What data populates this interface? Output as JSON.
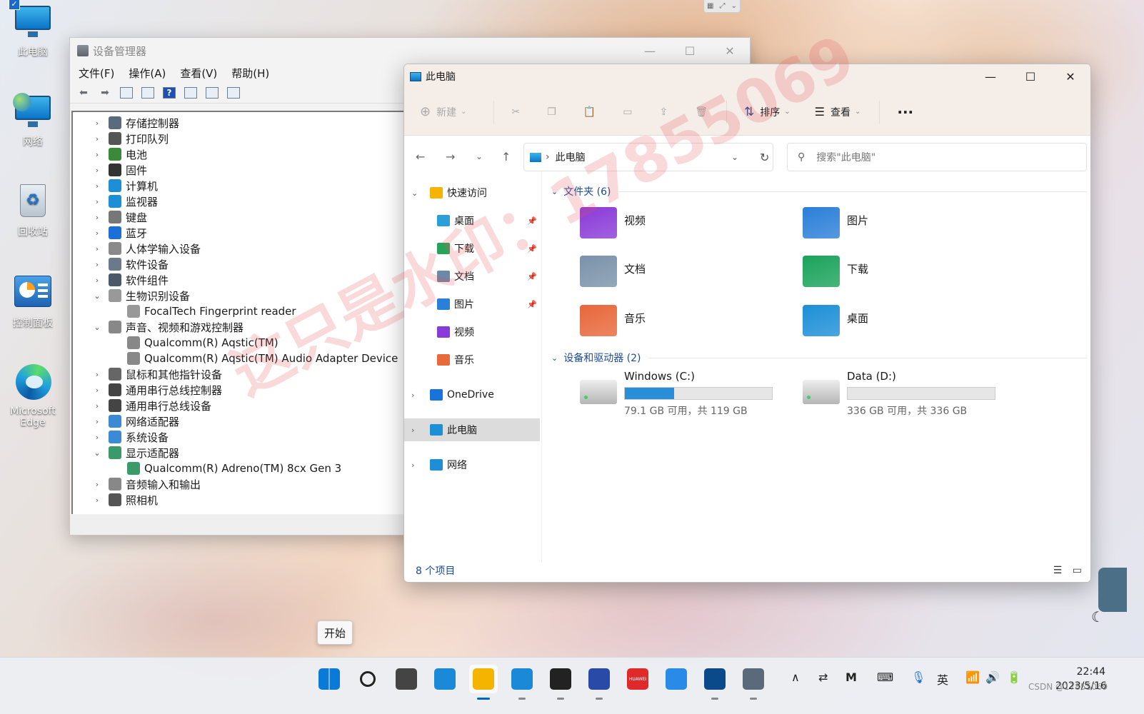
{
  "desktop": {
    "icons": [
      {
        "label": "此电脑",
        "icon": "this-pc-icon"
      },
      {
        "label": "网络",
        "icon": "network-icon"
      },
      {
        "label": "回收站",
        "icon": "recycle-bin-icon"
      },
      {
        "label": "控制面板",
        "icon": "control-panel-icon"
      },
      {
        "label": "Microsoft Edge",
        "icon": "edge-icon"
      }
    ]
  },
  "device_manager": {
    "title": "设备管理器",
    "menu": [
      "文件(F)",
      "操作(A)",
      "查看(V)",
      "帮助(H)"
    ],
    "tree": [
      {
        "label": "存储控制器",
        "level": 0,
        "expanded": false,
        "color": "#5a6b7d"
      },
      {
        "label": "打印队列",
        "level": 0,
        "expanded": false,
        "color": "#555555"
      },
      {
        "label": "电池",
        "level": 0,
        "expanded": false,
        "color": "#3a8a3a"
      },
      {
        "label": "固件",
        "level": 0,
        "expanded": false,
        "color": "#333333"
      },
      {
        "label": "计算机",
        "level": 0,
        "expanded": false,
        "color": "#1c8fd6"
      },
      {
        "label": "监视器",
        "level": 0,
        "expanded": false,
        "color": "#1c8fd6"
      },
      {
        "label": "键盘",
        "level": 0,
        "expanded": false,
        "color": "#777777"
      },
      {
        "label": "蓝牙",
        "level": 0,
        "expanded": false,
        "color": "#1a6fd8"
      },
      {
        "label": "人体学输入设备",
        "level": 0,
        "expanded": false,
        "color": "#8a8a8a"
      },
      {
        "label": "软件设备",
        "level": 0,
        "expanded": false,
        "color": "#6a7a8a"
      },
      {
        "label": "软件组件",
        "level": 0,
        "expanded": false,
        "color": "#4a5a6a"
      },
      {
        "label": "生物识别设备",
        "level": 0,
        "expanded": true,
        "color": "#999999"
      },
      {
        "label": "FocalTech Fingerprint reader",
        "level": 1,
        "color": "#999999"
      },
      {
        "label": "声音、视频和游戏控制器",
        "level": 0,
        "expanded": true,
        "color": "#888888"
      },
      {
        "label": "Qualcomm(R) Aqstic(TM)",
        "level": 1,
        "color": "#888888"
      },
      {
        "label": "Qualcomm(R) Aqstic(TM) Audio Adapter Device",
        "level": 1,
        "color": "#888888"
      },
      {
        "label": "鼠标和其他指针设备",
        "level": 0,
        "expanded": false,
        "color": "#666666"
      },
      {
        "label": "通用串行总线控制器",
        "level": 0,
        "expanded": false,
        "color": "#444444"
      },
      {
        "label": "通用串行总线设备",
        "level": 0,
        "expanded": false,
        "color": "#444444"
      },
      {
        "label": "网络适配器",
        "level": 0,
        "expanded": false,
        "color": "#3a8ad6"
      },
      {
        "label": "系统设备",
        "level": 0,
        "expanded": false,
        "color": "#3a8ad6"
      },
      {
        "label": "显示适配器",
        "level": 0,
        "expanded": true,
        "color": "#3a9a6a"
      },
      {
        "label": "Qualcomm(R) Adreno(TM) 8cx Gen 3",
        "level": 1,
        "color": "#3a9a6a"
      },
      {
        "label": "音频输入和输出",
        "level": 0,
        "expanded": false,
        "color": "#888888"
      },
      {
        "label": "照相机",
        "level": 0,
        "expanded": false,
        "color": "#555555"
      }
    ]
  },
  "explorer": {
    "title": "此电脑",
    "commands": [
      {
        "label": "新建",
        "enabled": false
      },
      {
        "label": "排序",
        "enabled": true
      },
      {
        "label": "查看",
        "enabled": true
      }
    ],
    "address": "此电脑",
    "search_placeholder": "搜索\"此电脑\"",
    "nav": [
      {
        "label": "快速访问",
        "type": "header",
        "icon": "star-icon",
        "color": "#f5b400"
      },
      {
        "label": "桌面",
        "type": "pinned",
        "icon": "desktop-icon",
        "color": "#2a9fd8"
      },
      {
        "label": "下载",
        "type": "pinned",
        "icon": "download-icon",
        "color": "#2aa35a"
      },
      {
        "label": "文档",
        "type": "pinned",
        "icon": "documents-icon",
        "color": "#6a8aa8"
      },
      {
        "label": "图片",
        "type": "pinned",
        "icon": "pictures-icon",
        "color": "#2a7fd8"
      },
      {
        "label": "视频",
        "type": "item",
        "icon": "videos-icon",
        "color": "#8a3ad8"
      },
      {
        "label": "音乐",
        "type": "item",
        "icon": "music-icon",
        "color": "#e86a3a"
      },
      {
        "label": "OneDrive",
        "type": "header",
        "icon": "onedrive-icon",
        "color": "#1a73d8"
      },
      {
        "label": "此电脑",
        "type": "header",
        "icon": "this-pc-icon",
        "color": "#1c8fd6",
        "selected": true
      },
      {
        "label": "网络",
        "type": "header",
        "icon": "network-icon",
        "color": "#1c8fd6"
      }
    ],
    "folders_header": "文件夹 (6)",
    "folders": [
      {
        "label": "视频",
        "icon": "videos-folder-icon",
        "color": "#8a3ad8"
      },
      {
        "label": "图片",
        "icon": "pictures-folder-icon",
        "color": "#2a7fd8"
      },
      {
        "label": "文档",
        "icon": "documents-folder-icon",
        "color": "#7a92aa"
      },
      {
        "label": "下载",
        "icon": "downloads-folder-icon",
        "color": "#1aa35a"
      },
      {
        "label": "音乐",
        "icon": "music-folder-icon",
        "color": "#e8673a"
      },
      {
        "label": "桌面",
        "icon": "desktop-folder-icon",
        "color": "#1c8fd6"
      }
    ],
    "drives_header": "设备和驱动器 (2)",
    "drives": [
      {
        "label": "Windows (C:)",
        "caption": "79.1 GB 可用，共 119 GB",
        "used_fraction": 0.335,
        "icon": "windows-drive-icon"
      },
      {
        "label": "Data (D:)",
        "caption": "336 GB 可用，共 336 GB",
        "used_fraction": 0.0,
        "icon": "drive-icon"
      }
    ],
    "status": "8 个项目"
  },
  "watermark": "这只是水印：17855069",
  "tooltip": "开始",
  "taskbar": {
    "apps": [
      {
        "name": "start-button",
        "color": "#0a7ad8",
        "active": false
      },
      {
        "name": "search-button",
        "color": "#222222",
        "active": false
      },
      {
        "name": "task-view-button",
        "color": "#444444",
        "active": false
      },
      {
        "name": "widgets-button",
        "color": "#1a8ad8",
        "active": false
      },
      {
        "name": "file-explorer-button",
        "color": "#f4b400",
        "active": true
      },
      {
        "name": "edge-button",
        "color": "#1a8ad8",
        "active": false
      },
      {
        "name": "store-button",
        "color": "#222222",
        "active": false
      },
      {
        "name": "meetime-button",
        "color": "#2a4aa8",
        "active": false
      },
      {
        "name": "huawei-button",
        "color": "#e02a2a",
        "active": false
      },
      {
        "name": "cloud-button",
        "color": "#2a8ae8",
        "active": false
      },
      {
        "name": "teamviewer-button",
        "color": "#0a4a8a",
        "active": false
      },
      {
        "name": "device-manager-button",
        "color": "#5a6a7a",
        "active": false
      }
    ],
    "huawei_label": "HUAWEI",
    "ime": "英",
    "time": "22:44",
    "date": "2023/5/16"
  },
  "credit": "CSDN @17855069"
}
